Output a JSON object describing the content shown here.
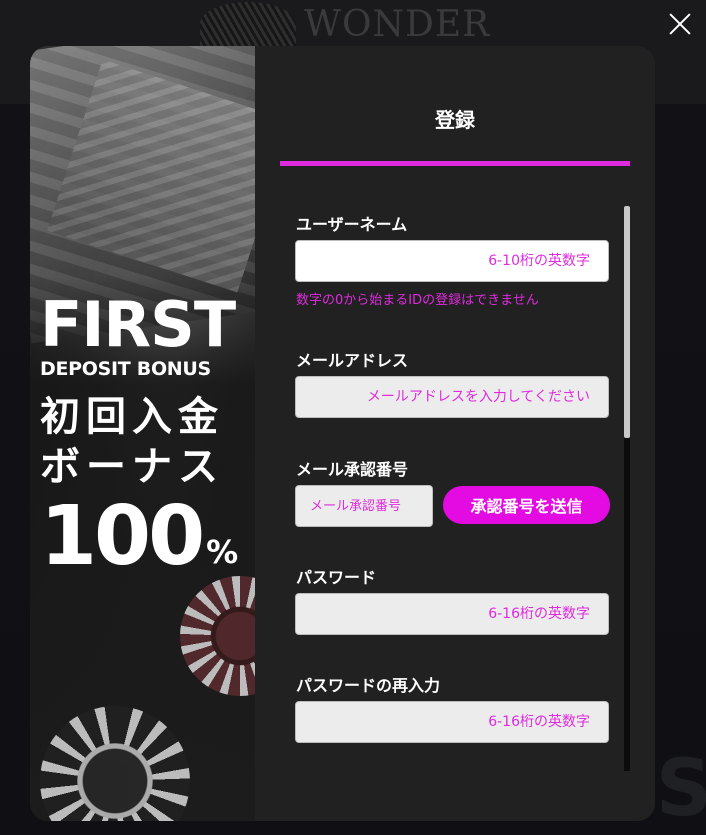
{
  "background": {
    "logo_text": "WONDER",
    "faded_text": "S"
  },
  "promo": {
    "line1": "FIRST",
    "line2": "DEPOSIT BONUS",
    "line3": "初回入金",
    "line4": "ボーナス",
    "percent_value": "100",
    "percent_sign": "%"
  },
  "form": {
    "title": "登録",
    "username": {
      "label": "ユーザーネーム",
      "placeholder": "6-10桁の英数字",
      "hint": "数字の0から始まるIDの登録はできません"
    },
    "email": {
      "label": "メールアドレス",
      "placeholder": "メールアドレスを入力してください"
    },
    "email_code": {
      "label": "メール承認番号",
      "placeholder": "メール承認番号",
      "send_button": "承認番号を送信"
    },
    "password": {
      "label": "パスワード",
      "placeholder": "6-16桁の英数字"
    },
    "password_confirm": {
      "label": "パスワードの再入力",
      "placeholder": "6-16桁の英数字"
    }
  },
  "colors": {
    "accent": "#e02adf",
    "button": "#e40be2",
    "panel": "#212121"
  },
  "icons": {
    "close": "close-icon"
  }
}
